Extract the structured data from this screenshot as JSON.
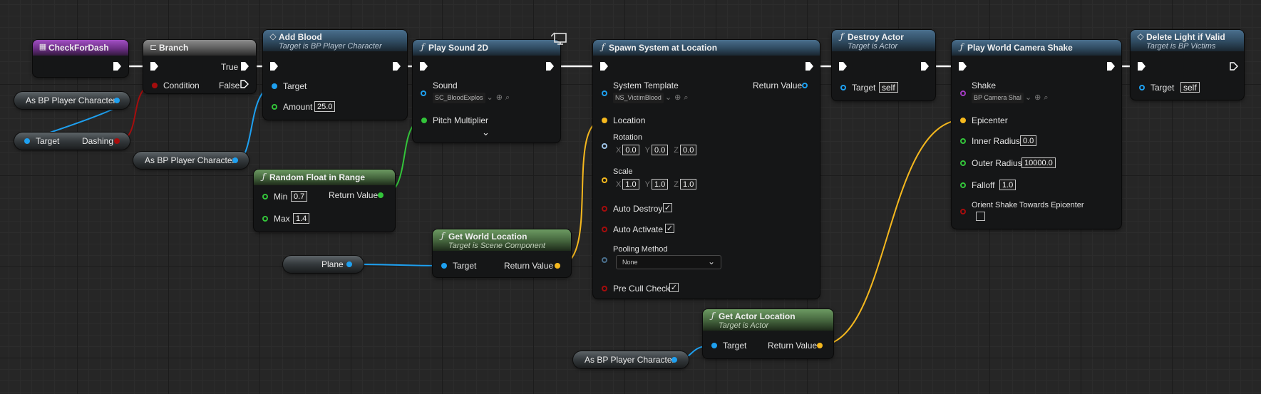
{
  "nodes": {
    "check_for_dash": {
      "title": "CheckForDash"
    },
    "branch": {
      "title": "Branch",
      "condition": "Condition",
      "true_label": "True",
      "false_label": "False"
    },
    "add_blood": {
      "title": "Add Blood",
      "subtitle": "Target is BP Player Character",
      "target": "Target",
      "amount_label": "Amount",
      "amount_value": "25.0"
    },
    "play_sound_2d": {
      "title": "Play Sound 2D",
      "sound_label": "Sound",
      "sound_value": "SC_BloodExplos",
      "pitch_label": "Pitch Multiplier",
      "expand": "⌄"
    },
    "random_float": {
      "title": "Random Float in Range",
      "min_label": "Min",
      "min_value": "0.7",
      "max_label": "Max",
      "max_value": "1.4",
      "return_label": "Return Value"
    },
    "get_world_location": {
      "title": "Get World Location",
      "subtitle": "Target is Scene Component",
      "target": "Target",
      "return_label": "Return Value"
    },
    "spawn_system": {
      "title": "Spawn System at Location",
      "template_label": "System Template",
      "template_value": "NS_VictimBlood",
      "return_label": "Return Value",
      "location_label": "Location",
      "rotation_label": "Rotation",
      "rotation": {
        "x": "0.0",
        "y": "0.0",
        "z": "0.0"
      },
      "scale_label": "Scale",
      "scale": {
        "x": "1.0",
        "y": "1.0",
        "z": "1.0"
      },
      "auto_destroy_label": "Auto Destroy",
      "auto_activate_label": "Auto Activate",
      "pooling_label": "Pooling Method",
      "pooling_value": "None",
      "pre_cull_label": "Pre Cull Check",
      "check_mark": "✓",
      "axis_x": "X",
      "axis_y": "Y",
      "axis_z": "Z"
    },
    "destroy_actor": {
      "title": "Destroy Actor",
      "subtitle": "Target is Actor",
      "target": "Target",
      "target_value": "self"
    },
    "camera_shake": {
      "title": "Play World Camera Shake",
      "shake_label": "Shake",
      "shake_value": "BP Camera Shal",
      "epicenter_label": "Epicenter",
      "inner_label": "Inner Radius",
      "inner_value": "0.0",
      "outer_label": "Outer Radius",
      "outer_value": "10000.0",
      "falloff_label": "Falloff",
      "falloff_value": "1.0",
      "orient_label": "Orient Shake Towards Epicenter"
    },
    "delete_light": {
      "title": "Delete Light if Valid",
      "subtitle": "Target is BP Victims",
      "target": "Target",
      "target_value": "self"
    },
    "get_actor_location": {
      "title": "Get Actor Location",
      "subtitle": "Target is Actor",
      "target": "Target",
      "return_label": "Return Value"
    }
  },
  "variables": {
    "as_bp_player_1": "As BP Player Character",
    "target_dashing_target": "Target",
    "target_dashing_dashing": "Dashing",
    "as_bp_player_2": "As BP Player Character",
    "plane": "Plane",
    "as_bp_player_3": "As BP Player Character"
  },
  "colors": {
    "object_pin": "#1ea0f0",
    "float_pin": "#33c43a",
    "bool_pin": "#a50d0d",
    "vector_pin": "#f5b81e",
    "shake_pin": "#a23ac2",
    "exec_pin": "#ffffff"
  },
  "icons": {
    "function": "function-icon",
    "branch": "branch-icon",
    "event": "event-icon",
    "macro": "diamond-icon",
    "client_only": "monitor-icon"
  }
}
